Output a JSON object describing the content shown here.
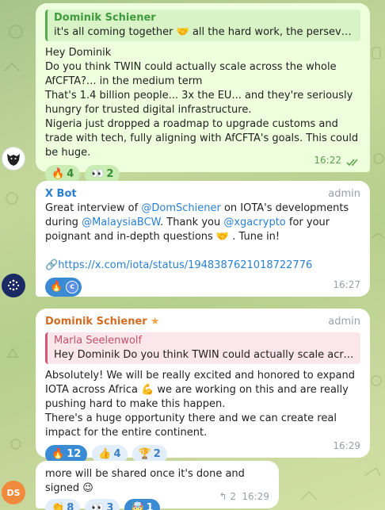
{
  "messages": {
    "m1": {
      "quote_name": "Dominik Schiener",
      "quote_text": "it's all coming together 🤝 all the hard work, the perseverance a...",
      "lines": [
        "Hey Dominik",
        "Do you think TWIN could actually scale across the whole AfCFTA?... in the medium term",
        "That's 1.4 billion people... 3x the EU... and they're seriously hungry for trusted digital infrastructure.",
        "Nigeria just dropped a roadmap to upgrade customs and trade with tech, fully aligning with AfCFTA's goals. This could be huge."
      ],
      "reactions": [
        {
          "emoji": "🔥",
          "count": "4"
        },
        {
          "emoji": "👀",
          "count": "2"
        }
      ],
      "time": "16:22"
    },
    "m2": {
      "sender": "X Bot",
      "role": "admin",
      "text_parts": {
        "a": "Great interview of ",
        "b": "@DomSchiener",
        "c": " on IOTA's developments during ",
        "d": "@MalaysiaBCW",
        "e": ". Thank you ",
        "f": "@xgacrypto",
        "g": " for your poignant and in-depth questions 🤝 . Tune in!"
      },
      "link_icon": "🔗",
      "link": "https://x.com/iota/status/1948387621018722776",
      "reaction_emoji": "🔥",
      "reactor_initial": "c",
      "time": "16:27"
    },
    "m3": {
      "sender": "Dominik Schiener",
      "star": "★",
      "role": "admin",
      "quote_name": "Marla Seelenwolf",
      "quote_text": "Hey Dominik Do you think TWIN could actually scale across the ...",
      "lines": [
        "Absolutely! We will be really excited and honored to expand IOTA across Africa 💪 we are working on this and are really pushing hard to make this happen.",
        "There's a huge opportunity there and we can create real impact for the entire continent."
      ],
      "reactions": [
        {
          "emoji": "🔥",
          "count": "12"
        },
        {
          "emoji": "👍",
          "count": "4"
        },
        {
          "emoji": "🏆",
          "count": "2"
        }
      ],
      "time": "16:29"
    },
    "m4": {
      "text": "more will be shared once it's done and signed 😉",
      "reactions": [
        {
          "emoji": "👏",
          "count": "8"
        },
        {
          "emoji": "👀",
          "count": "3"
        },
        {
          "emoji": "🤯",
          "count": "1"
        }
      ],
      "replies": "2",
      "time": "16:29"
    }
  },
  "avatars": {
    "ds_initials": "DS"
  },
  "colors": {
    "outgoing_bg": "#eeffde",
    "incoming_bg": "#ffffff",
    "accent_blue": "#2b7fd1",
    "accent_orange": "#d36c23",
    "quote_green": "#5aa84f",
    "quote_pink": "#d6577a"
  }
}
